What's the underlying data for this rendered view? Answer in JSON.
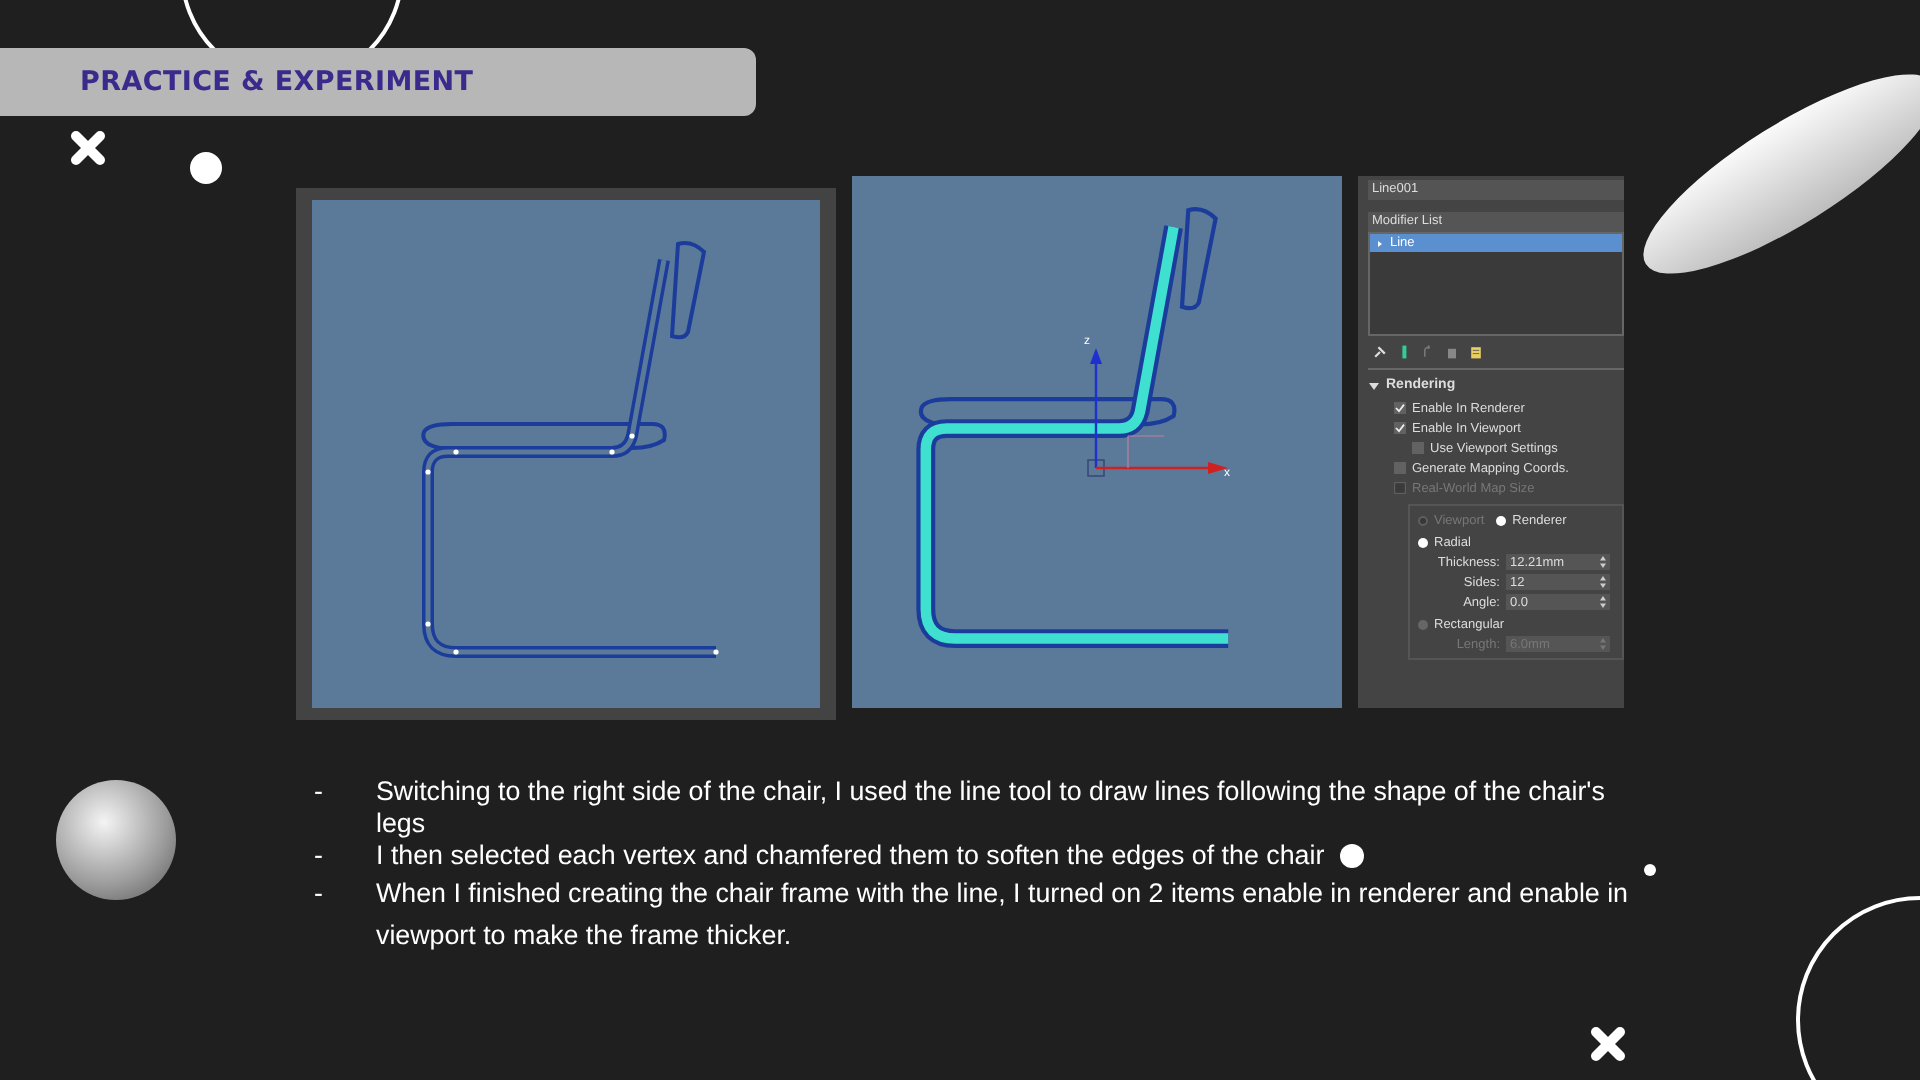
{
  "header": {
    "title": "PRACTICE & EXPERIMENT"
  },
  "viewports": [
    {
      "kind": "vertex-edit"
    },
    {
      "kind": "rendered",
      "axis_labels": [
        "z",
        "x"
      ]
    }
  ],
  "panel": {
    "object_name": "Line001",
    "modifier_list_label": "Modifier List",
    "modifiers": [
      {
        "label": "Line",
        "selected": true
      }
    ],
    "rollout": {
      "title": "Rendering",
      "expanded": true
    },
    "options": [
      {
        "label": "Enable In Renderer",
        "checked": true,
        "disabled": false
      },
      {
        "label": "Enable In Viewport",
        "checked": true,
        "disabled": false
      },
      {
        "label": "Use Viewport Settings",
        "checked": false,
        "disabled": false
      },
      {
        "label": "Generate Mapping Coords.",
        "checked": false,
        "disabled": false
      },
      {
        "label": "Real-World Map Size",
        "checked": false,
        "disabled": true
      }
    ],
    "modes": [
      {
        "label": "Viewport",
        "selected": false,
        "disabled": true
      },
      {
        "label": "Renderer",
        "selected": true,
        "disabled": false
      }
    ],
    "profiles": [
      {
        "label": "Radial",
        "selected": true,
        "fields": [
          {
            "label": "Thickness:",
            "value": "12.21mm",
            "disabled": false
          },
          {
            "label": "Sides:",
            "value": "12",
            "disabled": false
          },
          {
            "label": "Angle:",
            "value": "0.0",
            "disabled": false
          }
        ]
      },
      {
        "label": "Rectangular",
        "selected": false,
        "fields": [
          {
            "label": "Length:",
            "value": "6.0mm",
            "disabled": true
          }
        ]
      }
    ]
  },
  "bullets": [
    {
      "marker": "-",
      "text": "Switching to the right side of the chair, I used the line tool to draw lines following the shape of the chair's legs"
    },
    {
      "marker": "-",
      "text": "I then selected each vertex and chamfered them to soften the edges of the chair"
    },
    {
      "marker": "-",
      "text": "When I finished  creating the chair frame with the line, I turned on 2 items enable in renderer and enable in viewport to make the frame thicker."
    }
  ]
}
